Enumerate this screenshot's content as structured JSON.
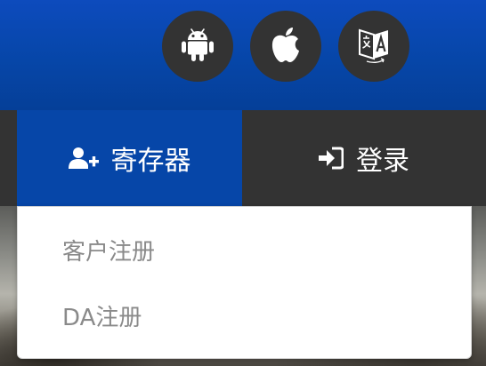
{
  "header": {
    "icons": [
      "android-icon",
      "apple-icon",
      "translate-icon"
    ]
  },
  "nav": {
    "register_label": "寄存器",
    "login_label": "登录"
  },
  "dropdown": {
    "items": [
      {
        "label": "客户注册"
      },
      {
        "label": "DA注册"
      }
    ]
  },
  "colors": {
    "brand_blue": "#0646a8",
    "dark_bar": "#333333",
    "icon_circle": "#333333",
    "menu_text": "#8a8a8a"
  }
}
